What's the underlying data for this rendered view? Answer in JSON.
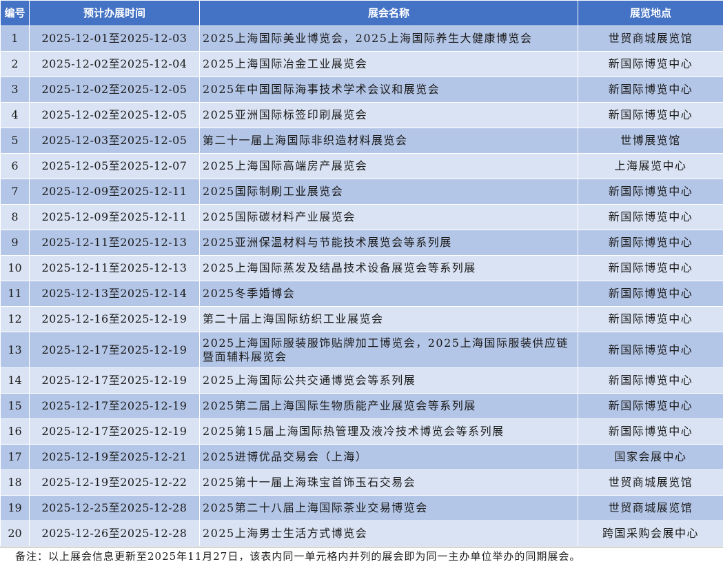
{
  "table": {
    "headers": [
      "编号",
      "预计办展时间",
      "展会名称",
      "展览地点"
    ],
    "rows": [
      {
        "num": "1",
        "date": "2025-12-01至2025-12-03",
        "name": "2025上海国际美业博览会，2025上海国际养生大健康博览会",
        "location": "世贸商城展览馆"
      },
      {
        "num": "2",
        "date": "2025-12-02至2025-12-04",
        "name": "2025上海国际冶金工业展览会",
        "location": "新国际博览中心"
      },
      {
        "num": "3",
        "date": "2025-12-02至2025-12-05",
        "name": "2025年中国国际海事技术学术会议和展览会",
        "location": "新国际博览中心"
      },
      {
        "num": "4",
        "date": "2025-12-02至2025-12-05",
        "name": "2025亚洲国际标签印刷展览会",
        "location": "新国际博览中心"
      },
      {
        "num": "5",
        "date": "2025-12-03至2025-12-05",
        "name": "第二十一届上海国际非织造材料展览会",
        "location": "世博展览馆"
      },
      {
        "num": "6",
        "date": "2025-12-05至2025-12-07",
        "name": "2025上海国际高端房产展览会",
        "location": "上海展览中心"
      },
      {
        "num": "7",
        "date": "2025-12-09至2025-12-11",
        "name": "2025国际制刷工业展览会",
        "location": "新国际博览中心"
      },
      {
        "num": "8",
        "date": "2025-12-09至2025-12-11",
        "name": "2025国际碳材料产业展览会",
        "location": "新国际博览中心"
      },
      {
        "num": "9",
        "date": "2025-12-11至2025-12-13",
        "name": "2025亚洲保温材料与节能技术展览会等系列展",
        "location": "新国际博览中心"
      },
      {
        "num": "10",
        "date": "2025-12-11至2025-12-13",
        "name": "2025上海国际蒸发及结晶技术设备展览会等系列展",
        "location": "新国际博览中心"
      },
      {
        "num": "11",
        "date": "2025-12-13至2025-12-14",
        "name": "2025冬季婚博会",
        "location": "新国际博览中心"
      },
      {
        "num": "12",
        "date": "2025-12-16至2025-12-19",
        "name": "第二十届上海国际纺织工业展览会",
        "location": "新国际博览中心"
      },
      {
        "num": "13",
        "date": "2025-12-17至2025-12-19",
        "name": "2025上海国际服装服饰贴牌加工博览会，2025上海国际服装供应链暨面辅料展览会",
        "location": "新国际博览中心"
      },
      {
        "num": "14",
        "date": "2025-12-17至2025-12-19",
        "name": "2025上海国际公共交通博览会等系列展",
        "location": "新国际博览中心"
      },
      {
        "num": "15",
        "date": "2025-12-17至2025-12-19",
        "name": "2025第二届上海国际生物质能产业展览会等系列展",
        "location": "新国际博览中心"
      },
      {
        "num": "16",
        "date": "2025-12-17至2025-12-19",
        "name": "2025第15届上海国际热管理及液冷技术博览会等系列展",
        "location": "新国际博览中心"
      },
      {
        "num": "17",
        "date": "2025-12-19至2025-12-21",
        "name": "2025进博优品交易会（上海）",
        "location": "国家会展中心"
      },
      {
        "num": "18",
        "date": "2025-12-19至2025-12-22",
        "name": "2025第十一届上海珠宝首饰玉石交易会",
        "location": "世贸商城展览馆"
      },
      {
        "num": "19",
        "date": "2025-12-25至2025-12-28",
        "name": "2025第二十八届上海国际茶业交易博览会",
        "location": "世贸商城展览馆"
      },
      {
        "num": "20",
        "date": "2025-12-26至2025-12-28",
        "name": "2025上海男士生活方式博览会",
        "location": "跨国采购会展中心"
      }
    ]
  },
  "note": "备注：以上展会信息更新至2025年11月27日，该表内同一单元格内并列的展会即为同一主办单位举办的同期展会。",
  "colors": {
    "header_bg": "#4472c4",
    "row_dark": "#b4c6e7",
    "row_light": "#dae3f3"
  }
}
